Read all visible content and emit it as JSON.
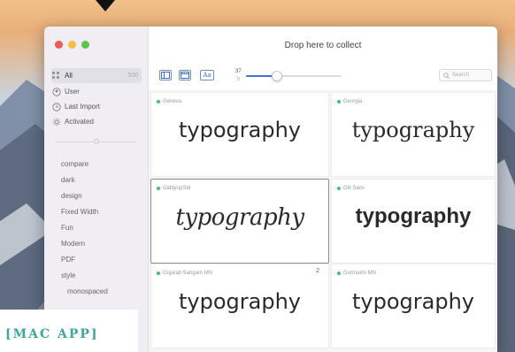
{
  "window": {
    "title": "Drop here to collect"
  },
  "sidebar": {
    "items": [
      {
        "label": "All",
        "count": "500",
        "icon": "grid-icon"
      },
      {
        "label": "User",
        "icon": "user-icon"
      },
      {
        "label": "Last Import",
        "icon": "clock-icon"
      },
      {
        "label": "Activated",
        "icon": "sun-icon"
      }
    ],
    "tags": [
      "compare",
      "dark",
      "design",
      "Fixed Width",
      "Fun",
      "Modern",
      "PDF",
      "style",
      "monospaced"
    ]
  },
  "toolbar": {
    "size_value": "37",
    "size_min": "0",
    "size_level": 0.32,
    "search_placeholder": "Search"
  },
  "fonts": [
    {
      "name": "Geneva",
      "sample": "typography",
      "style": "s-geneva",
      "badge": ""
    },
    {
      "name": "Georgia",
      "sample": "typography",
      "style": "s-georgia",
      "badge": ""
    },
    {
      "name": "GiddyupStd",
      "sample": "typography",
      "style": "s-giddy",
      "badge": ""
    },
    {
      "name": "Gill Sans",
      "sample": "typography",
      "style": "s-gill",
      "badge": ""
    },
    {
      "name": "Gujarati Sangam MN",
      "sample": "typography",
      "style": "s-gujarati",
      "badge": "2"
    },
    {
      "name": "Gurmukhi MN",
      "sample": "typography",
      "style": "s-gurmukhi",
      "badge": ""
    }
  ],
  "overlay": {
    "label": "[MAC APP]"
  },
  "colors": {
    "accent": "#3b74d6",
    "activated_dot": "#3ec46d",
    "banner_text": "#3aa7a0"
  }
}
